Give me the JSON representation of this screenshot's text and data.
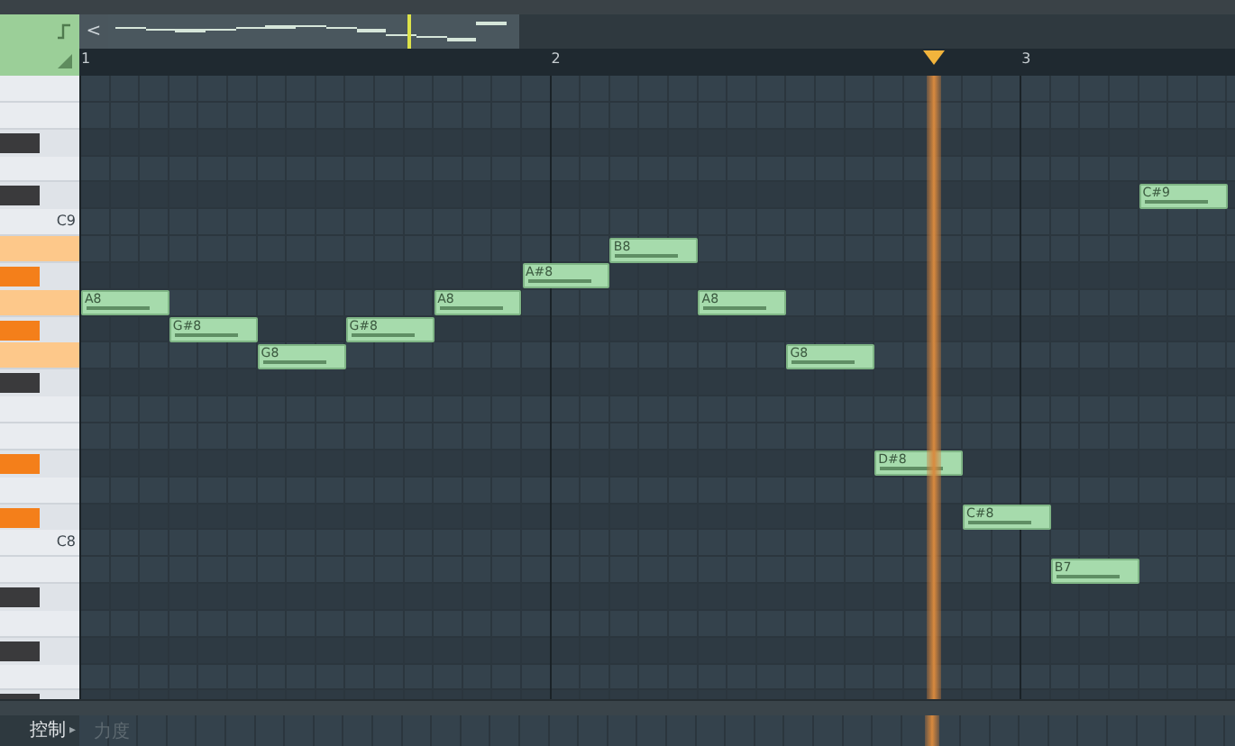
{
  "overview": {
    "back_button": "<",
    "playhead": {
      "level": 0.73
    }
  },
  "ruler": {
    "bars": [
      "1",
      "2",
      "3"
    ],
    "playhead": {
      "level": 0.74
    }
  },
  "keys": [
    {
      "kind": "white",
      "lit": false
    },
    {
      "kind": "white",
      "lit": false
    },
    {
      "kind": "black",
      "lit": false
    },
    {
      "kind": "white",
      "lit": false
    },
    {
      "kind": "black",
      "lit": false
    },
    {
      "kind": "white",
      "lit": false,
      "label": "C9"
    },
    {
      "kind": "white",
      "lit": true
    },
    {
      "kind": "black",
      "lit": true
    },
    {
      "kind": "white",
      "lit": true
    },
    {
      "kind": "black",
      "lit": true
    },
    {
      "kind": "white",
      "lit": true
    },
    {
      "kind": "black",
      "lit": false
    },
    {
      "kind": "white",
      "lit": false
    },
    {
      "kind": "white",
      "lit": false
    },
    {
      "kind": "black",
      "lit": true
    },
    {
      "kind": "white",
      "lit": false
    },
    {
      "kind": "black",
      "lit": true
    },
    {
      "kind": "white",
      "lit": false,
      "label": "C8"
    },
    {
      "kind": "white",
      "lit": false
    },
    {
      "kind": "black",
      "lit": false
    },
    {
      "kind": "white",
      "lit": false
    },
    {
      "kind": "black",
      "lit": false
    },
    {
      "kind": "white",
      "lit": false
    },
    {
      "kind": "black",
      "lit": false
    }
  ],
  "notes": [
    {
      "label": "A8",
      "level": 0.78
    },
    {
      "label": "G#8",
      "level": 0.78
    },
    {
      "label": "G8",
      "level": 0.78
    },
    {
      "label": "G#8",
      "level": 0.78
    },
    {
      "label": "A8",
      "level": 0.78
    },
    {
      "label": "A#8",
      "level": 0.78
    },
    {
      "label": "B8",
      "level": 0.78
    },
    {
      "label": "A8",
      "level": 0.78
    },
    {
      "label": "G8",
      "level": 0.78
    },
    {
      "label": "D#8",
      "level": 0.78
    },
    {
      "label": "C#8",
      "level": 0.78
    },
    {
      "label": "B7",
      "level": 0.78
    },
    {
      "label": "C#9",
      "level": 0.78
    }
  ],
  "event_panel": {
    "label": "控制",
    "arrow": "▸",
    "placeholder": "力度"
  }
}
